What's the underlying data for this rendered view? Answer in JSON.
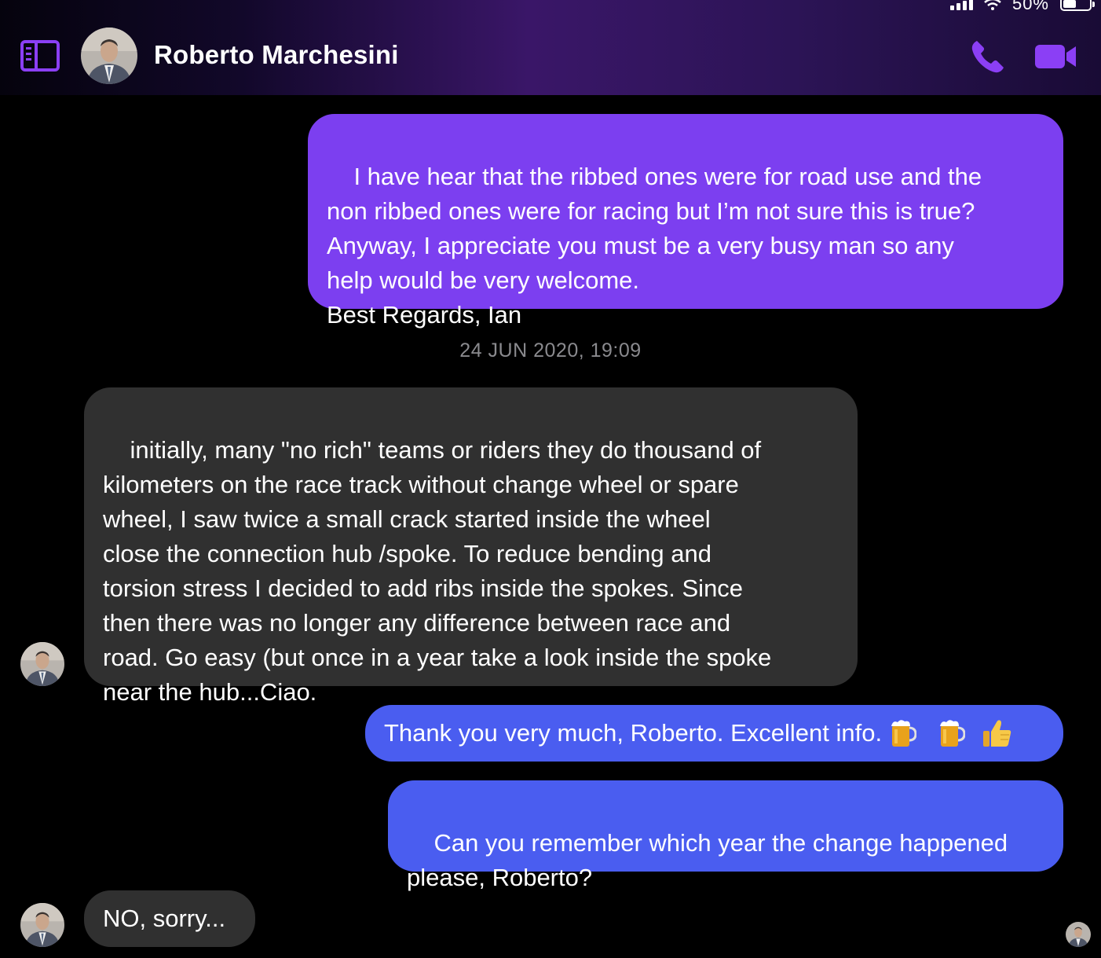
{
  "status_bar": {
    "battery_pct": "50%"
  },
  "header": {
    "contact_name": "Roberto Marchesini"
  },
  "icons": {
    "sidebar": "sidebar-toggle-icon",
    "call": "phone-icon",
    "video": "video-camera-icon"
  },
  "colors": {
    "accent": "#8b3ff5",
    "sent_purple": "#7c3ff0",
    "sent_blue": "#4a5df0",
    "received": "#303030",
    "timestamp": "#8a8a8e"
  },
  "messages": [
    {
      "direction": "sent",
      "text": "I have hear that the ribbed ones were for road use and the\nnon ribbed ones were for racing but I’m not sure this is true?\nAnyway, I appreciate you must be a very busy man so any\nhelp would be very welcome.\nBest Regards, Ian"
    },
    {
      "direction": "received",
      "text": "initially, many \"no rich\" teams or riders they do thousand of\nkilometers on the race track without change wheel or spare\nwheel, I saw twice a small crack started inside the wheel\nclose the connection hub /spoke. To reduce bending and\ntorsion stress I decided to add ribs inside the spokes. Since\nthen there was no longer any difference between race and\nroad. Go easy (but once in a year take a look inside the spoke\nnear the hub...Ciao."
    },
    {
      "direction": "sent",
      "text": "Thank you very much, Roberto. Excellent info.",
      "emojis": [
        "beer-mug-icon",
        "beer-mug-icon",
        "thumbs-up-icon"
      ]
    },
    {
      "direction": "sent",
      "text": "Can you remember which year the change happened\nplease, Roberto?"
    },
    {
      "direction": "received",
      "text": "NO, sorry..."
    }
  ],
  "timestamp": "24 JUN 2020, 19:09"
}
